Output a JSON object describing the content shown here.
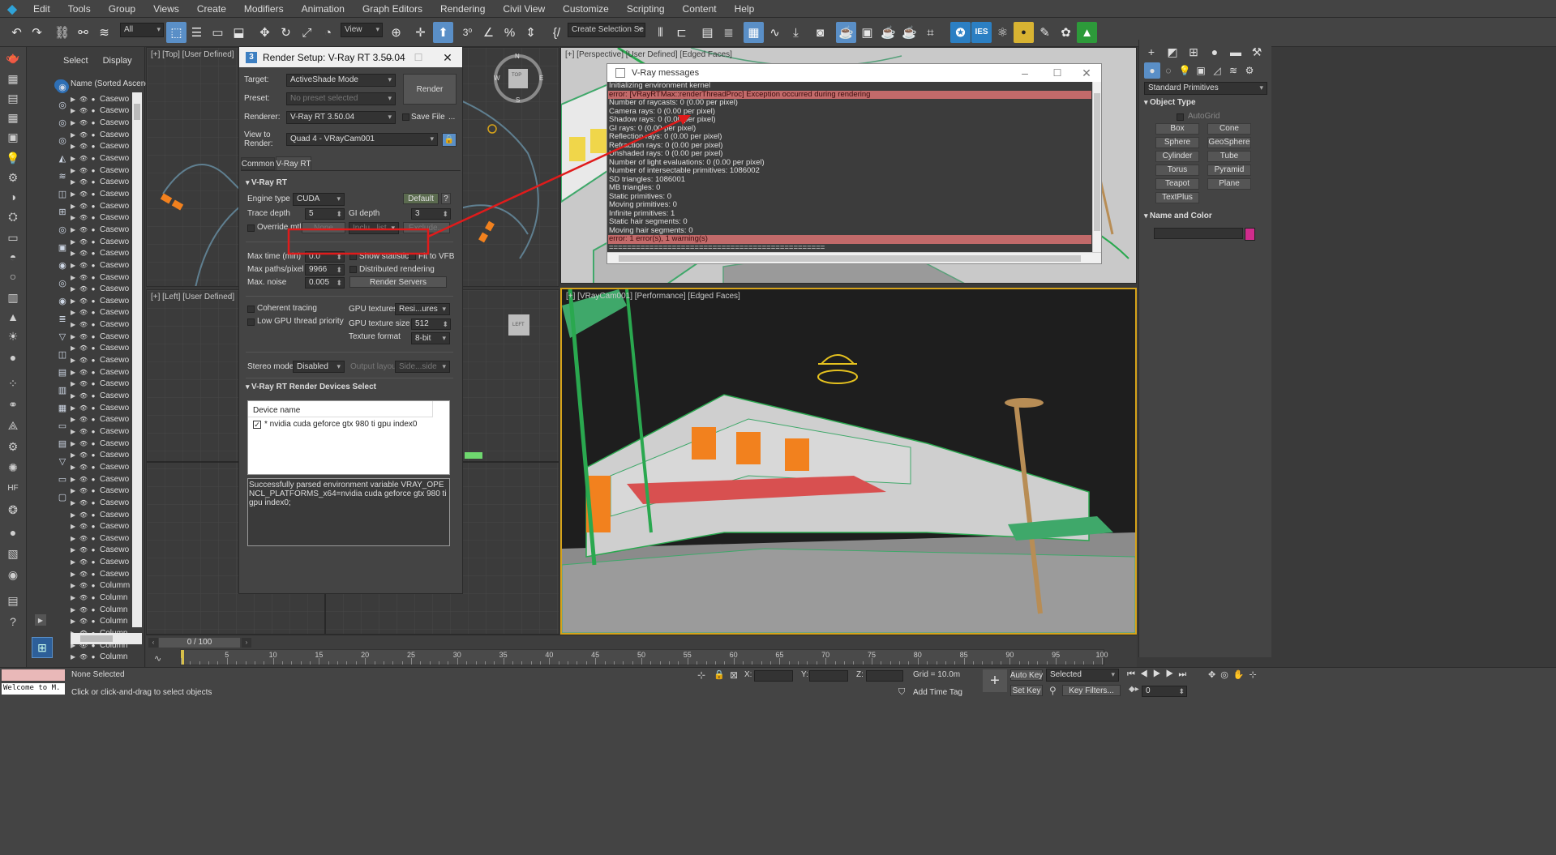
{
  "menu": {
    "items": [
      "Edit",
      "Tools",
      "Group",
      "Views",
      "Create",
      "Modifiers",
      "Animation",
      "Graph Editors",
      "Rendering",
      "Civil View",
      "Customize",
      "Scripting",
      "Content",
      "Help"
    ]
  },
  "toolbar": {
    "filter": "All",
    "view": "View",
    "selection_set": "Create Selection Se",
    "ies": "IES"
  },
  "scene_explorer": {
    "tabs": {
      "select": "Select",
      "display": "Display"
    },
    "header": "Name (Sorted Ascend",
    "rows": [
      "Casewo",
      "Casewo",
      "Casewo",
      "Casewo",
      "Casewo",
      "Casewo",
      "Casewo",
      "Casewo",
      "Casewo",
      "Casewo",
      "Casewo",
      "Casewo",
      "Casewo",
      "Casewo",
      "Casewo",
      "Casewo",
      "Casewo",
      "Casewo",
      "Casewo",
      "Casewo",
      "Casewo",
      "Casewo",
      "Casewo",
      "Casewo",
      "Casewo",
      "Casewo",
      "Casewo",
      "Casewo",
      "Casewo",
      "Casewo",
      "Casewo",
      "Casewo",
      "Casewo",
      "Casewo",
      "Casewo",
      "Casewo",
      "Casewo",
      "Casewo",
      "Casewo",
      "Casewo",
      "Casewo",
      "Columm",
      "Column",
      "Column",
      "Column",
      "Column",
      "Column",
      "Column"
    ]
  },
  "viewports": {
    "top": "[+] [Top] [User Defined]",
    "left": "[+] [Left] [User Defined]",
    "perspective": "[+] [Perspective] [User Defined] [Edged Faces]",
    "camera": "[+] [VRayCam001] [Performance] [Edged Faces]",
    "viewcube_top": "TOP",
    "viewcube_left": "LEFT",
    "compass": {
      "n": "N",
      "w": "W",
      "e": "E",
      "s": "S"
    }
  },
  "render_setup": {
    "title": "Render Setup: V-Ray RT 3.50.04",
    "target_label": "Target:",
    "target": "ActiveShade Mode",
    "preset_label": "Preset:",
    "preset": "No preset selected",
    "renderer_label": "Renderer:",
    "renderer": "V-Ray RT 3.50.04",
    "save_file": "Save File",
    "more": "...",
    "view_label": "View to\nRender:",
    "view": "Quad 4 - VRayCam001",
    "render_button": "Render",
    "tabs": [
      "Common",
      "V-Ray RT"
    ],
    "section_rt": "V-Ray RT",
    "engine_label": "Engine type",
    "engine": "CUDA",
    "default_button": "Default",
    "help": "?",
    "trace_depth_label": "Trace depth",
    "trace_depth": "5",
    "gi_depth_label": "GI depth",
    "gi_depth": "3",
    "override_mtl": "Override mtl",
    "none_button": "None",
    "inclu_list": "Inclu...list",
    "exclude": "Exclude...",
    "max_time_label": "Max time (min)",
    "max_time": "0.0",
    "show_statistics": "Show statistics",
    "fit_to_vfb": "Fit to VFB",
    "max_paths_label": "Max paths/pixel",
    "max_paths": "9966",
    "distributed": "Distributed rendering",
    "max_noise_label": "Max. noise",
    "max_noise": "0.005",
    "render_servers": "Render Servers",
    "coherent": "Coherent tracing",
    "low_gpu": "Low GPU thread priority",
    "gpu_textures_label": "GPU textures",
    "gpu_textures": "Resi...ures",
    "gpu_tex_size_label": "GPU texture size",
    "gpu_tex_size": "512",
    "tex_format_label": "Texture format",
    "tex_format": "8-bit",
    "stereo_label": "Stereo mode",
    "stereo": "Disabled",
    "output_layout_label": "Output layout",
    "output_layout": "Side...side",
    "section_devices": "V-Ray RT Render Devices Select",
    "device_header": "Device name",
    "device": "* nvidia cuda geforce gtx 980 ti gpu index0",
    "env_msg": "Successfully parsed environment variable VRAY_OPENCL_PLATFORMS_x64=nvidia cuda geforce gtx 980 ti gpu index0;"
  },
  "vray_messages": {
    "title": "V-Ray messages",
    "lines": [
      {
        "t": "Initializing environment kernel",
        "e": false
      },
      {
        "t": "error: [VRayRTMax::renderThreadProc] Exception occurred during rendering",
        "e": true
      },
      {
        "t": "Number of raycasts: 0 (0.00 per pixel)",
        "e": false
      },
      {
        "t": "  Camera rays: 0 (0.00 per pixel)",
        "e": false
      },
      {
        "t": "  Shadow rays: 0 (0.00 per pixel)",
        "e": false
      },
      {
        "t": "  GI rays: 0 (0.00 per pixel)",
        "e": false
      },
      {
        "t": "  Reflection rays: 0 (0.00 per pixel)",
        "e": false
      },
      {
        "t": "  Refraction rays: 0 (0.00 per pixel)",
        "e": false
      },
      {
        "t": "  Unshaded rays: 0 (0.00 per pixel)",
        "e": false
      },
      {
        "t": "Number of light evaluations: 0 (0.00 per pixel)",
        "e": false
      },
      {
        "t": "Number of intersectable primitives: 1086002",
        "e": false
      },
      {
        "t": "  SD triangles: 1086001",
        "e": false
      },
      {
        "t": "  MB triangles: 0",
        "e": false
      },
      {
        "t": "  Static primitives: 0",
        "e": false
      },
      {
        "t": "  Moving primitives: 0",
        "e": false
      },
      {
        "t": "  Infinite primitives: 1",
        "e": false
      },
      {
        "t": "  Static hair segments: 0",
        "e": false
      },
      {
        "t": "  Moving hair segments: 0",
        "e": false
      },
      {
        "t": "error: 1 error(s), 1 warning(s)",
        "e": true
      },
      {
        "t": "================================================",
        "e": false
      }
    ]
  },
  "command_panel": {
    "category": "Standard Primitives",
    "object_type": "Object Type",
    "autogrid": "AutoGrid",
    "buttons": [
      "Box",
      "Cone",
      "Sphere",
      "GeoSphere",
      "Cylinder",
      "Tube",
      "Torus",
      "Pyramid",
      "Teapot",
      "Plane",
      "TextPlus"
    ],
    "name_and_color": "Name and Color",
    "swatch_color": "#d02c8c"
  },
  "timeline": {
    "frame": "0 / 100",
    "ticks": [
      "5",
      "10",
      "15",
      "20",
      "25",
      "30",
      "35",
      "40",
      "45",
      "50",
      "55",
      "60",
      "65",
      "70",
      "75",
      "80",
      "85",
      "90",
      "95",
      "100"
    ]
  },
  "status": {
    "listener": "Welcome to M.",
    "selection": "None Selected",
    "prompt": "Click or click-and-drag to select objects",
    "x_label": "X:",
    "y_label": "Y:",
    "z_label": "Z:",
    "grid": "Grid = 10.0m",
    "add_time_tag": "Add Time Tag",
    "auto_key": "Auto Key",
    "set_key": "Set Key",
    "selected": "Selected",
    "key_filters": "Key Filters...",
    "frame_field": "0"
  },
  "colors": {
    "error_row": "#c26a6a",
    "annotation": "#e01b1b",
    "accent": "#5a8fc7"
  }
}
